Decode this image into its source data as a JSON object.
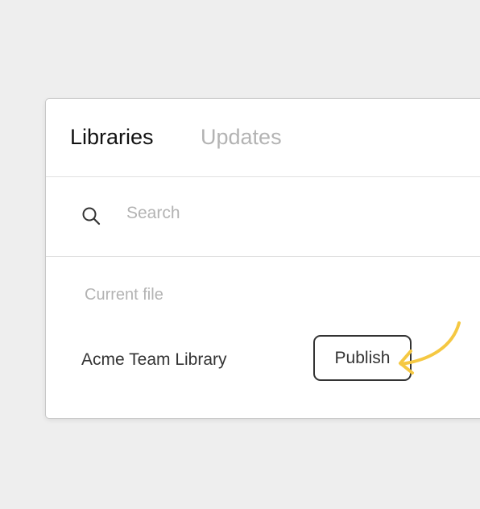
{
  "tabs": [
    {
      "label": "Libraries",
      "active": true
    },
    {
      "label": "Updates",
      "active": false
    }
  ],
  "search": {
    "placeholder": "Search",
    "value": ""
  },
  "section_label": "Current file",
  "library": {
    "name": "Acme Team Library",
    "publish_label": "Publish"
  },
  "colors": {
    "background": "#eeeeee",
    "arrow": "#f5c842",
    "border": "#333333"
  }
}
